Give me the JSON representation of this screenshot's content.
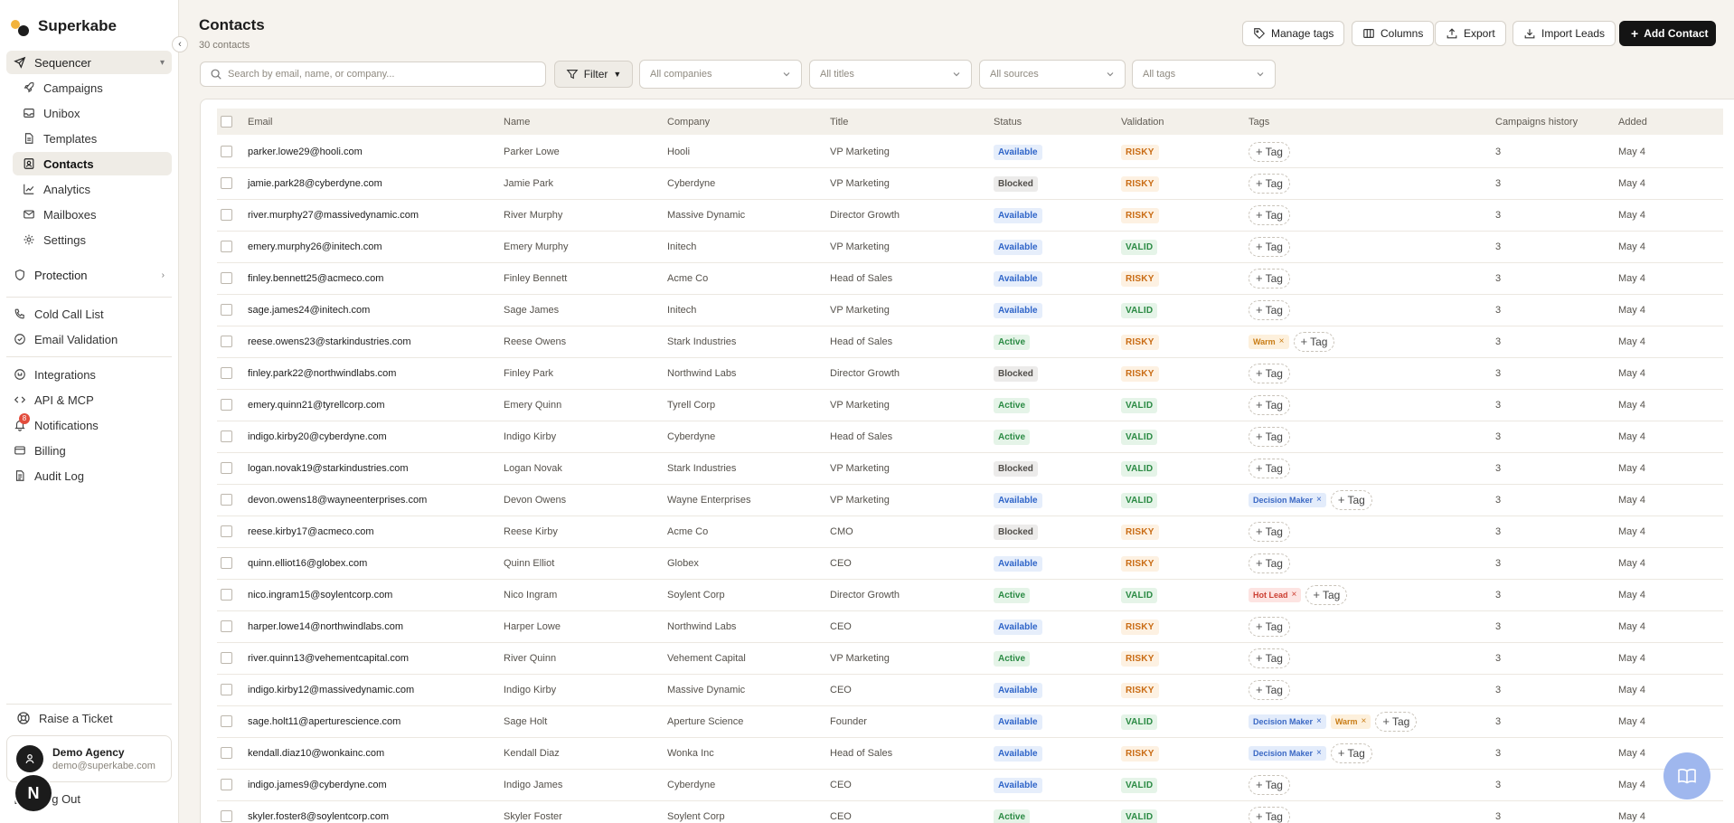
{
  "brand": {
    "name": "Superkabe"
  },
  "sidebar": {
    "sequencer": {
      "label": "Sequencer"
    },
    "items": [
      {
        "label": "Campaigns",
        "icon": "rocket-icon"
      },
      {
        "label": "Unibox",
        "icon": "inbox-icon"
      },
      {
        "label": "Templates",
        "icon": "document-icon"
      },
      {
        "label": "Contacts",
        "icon": "contacts-icon",
        "active": true
      },
      {
        "label": "Analytics",
        "icon": "chart-icon"
      },
      {
        "label": "Mailboxes",
        "icon": "mailbox-icon"
      },
      {
        "label": "Settings",
        "icon": "gear-icon"
      }
    ],
    "protection": {
      "label": "Protection"
    },
    "tools": [
      {
        "label": "Cold Call List",
        "icon": "phone-icon"
      },
      {
        "label": "Email Validation",
        "icon": "check-circle-icon"
      }
    ],
    "account": [
      {
        "label": "Integrations",
        "icon": "plug-icon"
      },
      {
        "label": "API & MCP",
        "icon": "code-icon"
      },
      {
        "label": "Notifications",
        "icon": "bell-icon",
        "badge": "8"
      },
      {
        "label": "Billing",
        "icon": "card-icon"
      },
      {
        "label": "Audit Log",
        "icon": "log-icon"
      }
    ],
    "raise_ticket": "Raise a Ticket",
    "user": {
      "name": "Demo Agency",
      "email": "demo@superkabe.com"
    },
    "logout": "og Out",
    "floating_initial": "N"
  },
  "header": {
    "title": "Contacts",
    "subtitle": "30 contacts",
    "buttons": {
      "manage_tags": "Manage tags",
      "columns": "Columns",
      "export": "Export",
      "import_leads": "Import Leads",
      "add_contact": "Add Contact"
    }
  },
  "filters": {
    "search_placeholder": "Search by email, name, or company...",
    "filter_label": "Filter",
    "companies": "All companies",
    "titles": "All titles",
    "sources": "All sources",
    "tags": "All tags"
  },
  "table": {
    "columns": {
      "email": "Email",
      "name": "Name",
      "company": "Company",
      "title": "Title",
      "status": "Status",
      "validation": "Validation",
      "tags": "Tags",
      "campaigns_history": "Campaigns history",
      "added": "Added"
    },
    "add_tag_label": "Tag",
    "rows": [
      {
        "email": "parker.lowe29@hooli.com",
        "name": "Parker Lowe",
        "company": "Hooli",
        "title": "VP Marketing",
        "status": "Available",
        "validation": "RISKY",
        "tags": [],
        "campaigns": "3",
        "added": "May 4"
      },
      {
        "email": "jamie.park28@cyberdyne.com",
        "name": "Jamie Park",
        "company": "Cyberdyne",
        "title": "VP Marketing",
        "status": "Blocked",
        "validation": "RISKY",
        "tags": [],
        "campaigns": "3",
        "added": "May 4"
      },
      {
        "email": "river.murphy27@massivedynamic.com",
        "name": "River Murphy",
        "company": "Massive Dynamic",
        "title": "Director Growth",
        "status": "Available",
        "validation": "RISKY",
        "tags": [],
        "campaigns": "3",
        "added": "May 4"
      },
      {
        "email": "emery.murphy26@initech.com",
        "name": "Emery Murphy",
        "company": "Initech",
        "title": "VP Marketing",
        "status": "Available",
        "validation": "VALID",
        "tags": [],
        "campaigns": "3",
        "added": "May 4"
      },
      {
        "email": "finley.bennett25@acmeco.com",
        "name": "Finley Bennett",
        "company": "Acme Co",
        "title": "Head of Sales",
        "status": "Available",
        "validation": "RISKY",
        "tags": [],
        "campaigns": "3",
        "added": "May 4"
      },
      {
        "email": "sage.james24@initech.com",
        "name": "Sage James",
        "company": "Initech",
        "title": "VP Marketing",
        "status": "Available",
        "validation": "VALID",
        "tags": [],
        "campaigns": "3",
        "added": "May 4"
      },
      {
        "email": "reese.owens23@starkindustries.com",
        "name": "Reese Owens",
        "company": "Stark Industries",
        "title": "Head of Sales",
        "status": "Active",
        "validation": "RISKY",
        "tags": [
          "Warm"
        ],
        "campaigns": "3",
        "added": "May 4"
      },
      {
        "email": "finley.park22@northwindlabs.com",
        "name": "Finley Park",
        "company": "Northwind Labs",
        "title": "Director Growth",
        "status": "Blocked",
        "validation": "RISKY",
        "tags": [],
        "campaigns": "3",
        "added": "May 4"
      },
      {
        "email": "emery.quinn21@tyrellcorp.com",
        "name": "Emery Quinn",
        "company": "Tyrell Corp",
        "title": "VP Marketing",
        "status": "Active",
        "validation": "VALID",
        "tags": [],
        "campaigns": "3",
        "added": "May 4"
      },
      {
        "email": "indigo.kirby20@cyberdyne.com",
        "name": "Indigo Kirby",
        "company": "Cyberdyne",
        "title": "Head of Sales",
        "status": "Active",
        "validation": "VALID",
        "tags": [],
        "campaigns": "3",
        "added": "May 4"
      },
      {
        "email": "logan.novak19@starkindustries.com",
        "name": "Logan Novak",
        "company": "Stark Industries",
        "title": "VP Marketing",
        "status": "Blocked",
        "validation": "VALID",
        "tags": [],
        "campaigns": "3",
        "added": "May 4"
      },
      {
        "email": "devon.owens18@wayneenterprises.com",
        "name": "Devon Owens",
        "company": "Wayne Enterprises",
        "title": "VP Marketing",
        "status": "Available",
        "validation": "VALID",
        "tags": [
          "Decision Maker"
        ],
        "campaigns": "3",
        "added": "May 4"
      },
      {
        "email": "reese.kirby17@acmeco.com",
        "name": "Reese Kirby",
        "company": "Acme Co",
        "title": "CMO",
        "status": "Blocked",
        "validation": "RISKY",
        "tags": [],
        "campaigns": "3",
        "added": "May 4"
      },
      {
        "email": "quinn.elliot16@globex.com",
        "name": "Quinn Elliot",
        "company": "Globex",
        "title": "CEO",
        "status": "Available",
        "validation": "RISKY",
        "tags": [],
        "campaigns": "3",
        "added": "May 4"
      },
      {
        "email": "nico.ingram15@soylentcorp.com",
        "name": "Nico Ingram",
        "company": "Soylent Corp",
        "title": "Director Growth",
        "status": "Active",
        "validation": "VALID",
        "tags": [
          "Hot Lead"
        ],
        "campaigns": "3",
        "added": "May 4"
      },
      {
        "email": "harper.lowe14@northwindlabs.com",
        "name": "Harper Lowe",
        "company": "Northwind Labs",
        "title": "CEO",
        "status": "Available",
        "validation": "RISKY",
        "tags": [],
        "campaigns": "3",
        "added": "May 4"
      },
      {
        "email": "river.quinn13@vehementcapital.com",
        "name": "River Quinn",
        "company": "Vehement Capital",
        "title": "VP Marketing",
        "status": "Active",
        "validation": "RISKY",
        "tags": [],
        "campaigns": "3",
        "added": "May 4"
      },
      {
        "email": "indigo.kirby12@massivedynamic.com",
        "name": "Indigo Kirby",
        "company": "Massive Dynamic",
        "title": "CEO",
        "status": "Available",
        "validation": "RISKY",
        "tags": [],
        "campaigns": "3",
        "added": "May 4"
      },
      {
        "email": "sage.holt11@aperturescience.com",
        "name": "Sage Holt",
        "company": "Aperture Science",
        "title": "Founder",
        "status": "Available",
        "validation": "VALID",
        "tags": [
          "Decision Maker",
          "Warm"
        ],
        "campaigns": "3",
        "added": "May 4"
      },
      {
        "email": "kendall.diaz10@wonkainc.com",
        "name": "Kendall Diaz",
        "company": "Wonka Inc",
        "title": "Head of Sales",
        "status": "Available",
        "validation": "RISKY",
        "tags": [
          "Decision Maker"
        ],
        "campaigns": "3",
        "added": "May 4"
      },
      {
        "email": "indigo.james9@cyberdyne.com",
        "name": "Indigo James",
        "company": "Cyberdyne",
        "title": "CEO",
        "status": "Available",
        "validation": "VALID",
        "tags": [],
        "campaigns": "3",
        "added": "May 4"
      },
      {
        "email": "skyler.foster8@soylentcorp.com",
        "name": "Skyler Foster",
        "company": "Soylent Corp",
        "title": "CEO",
        "status": "Active",
        "validation": "VALID",
        "tags": [],
        "campaigns": "3",
        "added": "May 4"
      }
    ]
  }
}
